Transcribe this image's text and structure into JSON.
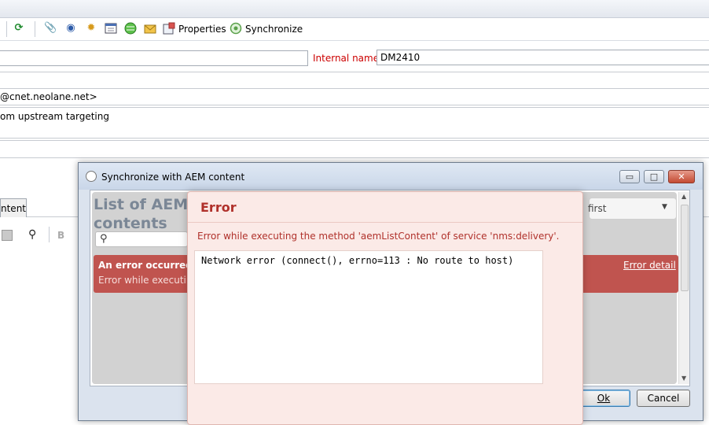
{
  "toolbar": {
    "properties_label": "Properties",
    "synchronize_label": "Synchronize"
  },
  "form": {
    "internal_name_label": "Internal name:",
    "internal_name_value": "DM2410",
    "sender_email_partial": "@cnet.neolane.net>",
    "targeting_partial": "om upstream targeting"
  },
  "tabs": {
    "content_partial": "ntent"
  },
  "editor_toolbar": {
    "bold_label": "B"
  },
  "dialog": {
    "title": "Synchronize with AEM content",
    "list_title_line1": "List of AEM e",
    "list_title_line2": "contents",
    "sort_select_value": "first",
    "error_banner_title": "An error occurred w",
    "error_banner_text": "Error while executing",
    "error_detail_link": "Error detail",
    "ok_label": "Ok",
    "cancel_label": "Cancel"
  },
  "error_modal": {
    "title": "Error",
    "message": "Error while executing the method 'aemListContent' of service 'nms:delivery'.",
    "detail": "Network error (connect(), errno=113 : No route to host)"
  },
  "colors": {
    "error_red": "#b0312b",
    "banner_red": "#c0544f",
    "label_red": "#cc0000"
  }
}
